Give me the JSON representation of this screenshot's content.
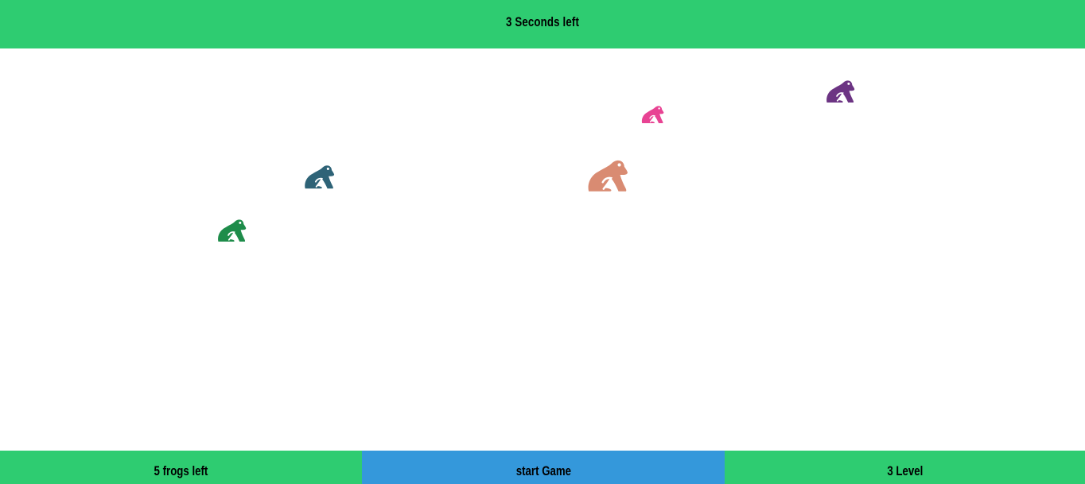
{
  "header": {
    "timer_text": "3 Seconds left"
  },
  "footer": {
    "frogs_left_text": "5 frogs left",
    "start_button_label": "start Game",
    "level_text": "3 Level"
  },
  "colors": {
    "bar_green": "#2ecc71",
    "button_blue": "#3498db",
    "background": "#ffffff"
  },
  "frogs": [
    {
      "icon": "frog-icon",
      "color": "#6c3483"
    },
    {
      "icon": "frog-icon",
      "color": "#e84393"
    },
    {
      "icon": "frog-icon",
      "color": "#2e6377"
    },
    {
      "icon": "frog-icon",
      "color": "#d98b72"
    },
    {
      "icon": "frog-icon",
      "color": "#1e8c4a"
    }
  ]
}
